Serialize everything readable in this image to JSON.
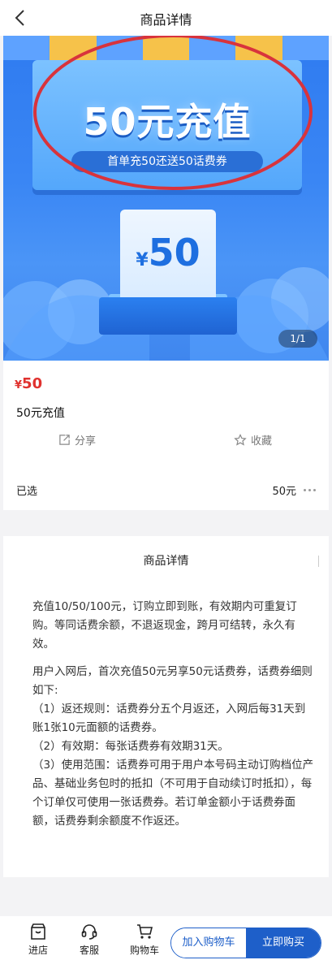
{
  "header": {
    "title": "商品详情"
  },
  "banner": {
    "headline": "50元充值",
    "subtitle": "首单充50还送50话费券",
    "receipt_currency": "¥",
    "receipt_amount": "50",
    "counter": "1/1",
    "accent": "#2f7bf0"
  },
  "product": {
    "currency": "¥",
    "price": "50",
    "name": "50元充值",
    "share_label": "分享",
    "favorite_label": "收藏",
    "price_color": "#e0322f"
  },
  "selected": {
    "label": "已选",
    "value": "50元"
  },
  "details": {
    "title": "商品详情",
    "paragraphs": [
      "充值10/50/100元，订购立即到账，有效期内可重复订购。等同话费余额，不退返现金，跨月可结转，永久有效。",
      "用户入网后，首次充值50元另享50元话费券，话费券细则如下:",
      "（1）返还规则：话费券分五个月返还，入网后每31天到账1张10元面额的话费券。",
      "（2）有效期：每张话费券有效期31天。",
      "（3）使用范围：话费券可用于用户本号码主动订购档位产品、基础业务包时的抵扣（不可用于自动续订时抵扣），每个订单仅可使用一张话费券。若订单金额小于话费券面额，话费券剩余额度不作返还。"
    ]
  },
  "bottom": {
    "store_label": "进店",
    "service_label": "客服",
    "cart_label": "购物车",
    "add_to_cart": "加入购物车",
    "buy_now": "立即购买",
    "brand_color": "#1e5fc9"
  }
}
